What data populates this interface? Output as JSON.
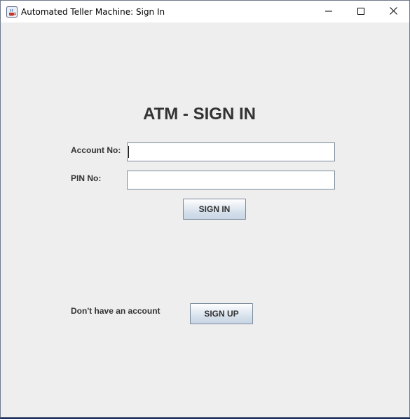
{
  "window": {
    "title": "Automated Teller Machine: Sign In",
    "icon": "java-cup-icon",
    "controls": [
      "minimize-icon",
      "maximize-icon",
      "close-icon"
    ]
  },
  "form": {
    "heading": "ATM - SIGN IN",
    "account_label": "Account No:",
    "account_value": "",
    "pin_label": "PIN No:",
    "pin_value": "",
    "signin_label": "SIGN IN"
  },
  "footer": {
    "prompt": "Don't have an account",
    "signup_label": "SIGN UP"
  },
  "colors": {
    "window_bg": "#eeeeee",
    "text": "#333333",
    "button_border": "#7a8a99"
  }
}
